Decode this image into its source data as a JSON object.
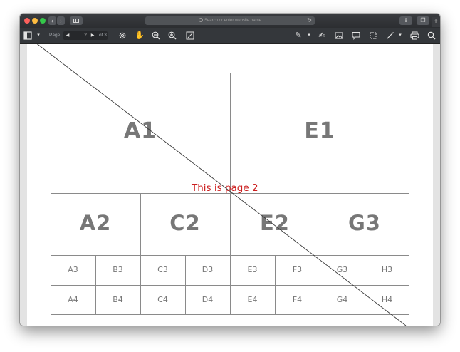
{
  "browser": {
    "address_placeholder": "Search or enter website name"
  },
  "toolbar": {
    "page_label": "Page",
    "current_page": "2",
    "of_label": "of 3"
  },
  "document": {
    "annotation": "This is page 2",
    "large_cells": [
      "A1",
      "E1"
    ],
    "medium_cells": [
      "A2",
      "C2",
      "E2",
      "G3"
    ],
    "small_row_1": [
      "A3",
      "B3",
      "C3",
      "D3",
      "E3",
      "F3",
      "G3",
      "H3"
    ],
    "small_row_2": [
      "A4",
      "B4",
      "C4",
      "D4",
      "E4",
      "F4",
      "G4",
      "H4"
    ]
  },
  "colors": {
    "annotation": "#cc1f1f",
    "toolbar_bg": "#34373b",
    "titlebar_bg": "#2c2e31"
  }
}
